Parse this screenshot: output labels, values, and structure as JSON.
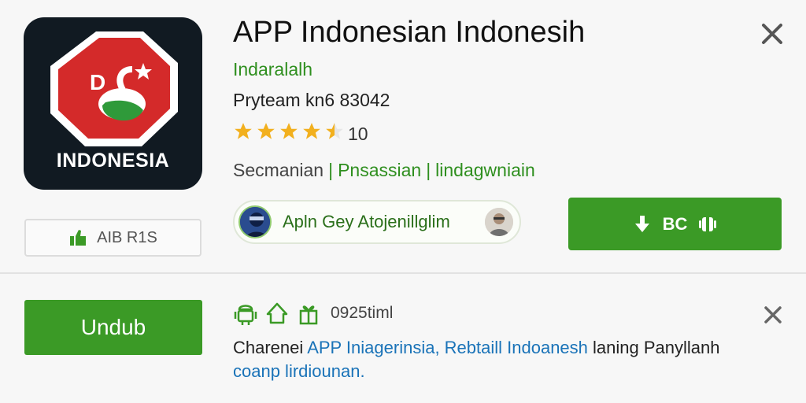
{
  "app": {
    "icon_text": "INDONESIA",
    "icon_badge": "D",
    "title": "APP Indonesian Indonesih",
    "developer": "Indaralalh",
    "subline": "Pryteam kn6 83042",
    "rating_count": "10",
    "rating_value": 4.5,
    "tags": [
      "Secmanian",
      "Pnsassian",
      "lindagwniain"
    ]
  },
  "rating_box": {
    "label": "AIB R1S",
    "icon": "thumbs-up-icon"
  },
  "user_pill": {
    "text": "Apln Gey Atojenillglim"
  },
  "install": {
    "label": "BC",
    "icon": "download-icon"
  },
  "bottom": {
    "download_label": "Undub",
    "size": "0925timl",
    "desc_plain_1": "Charenei ",
    "desc_link_1": "APP Iniagerinsia, Rebtaill Indoanesh",
    "desc_plain_2": " laning Panyllanh",
    "desc_link_2": "coanp lirdiounan."
  },
  "colors": {
    "accent_green": "#3b9a26",
    "text_green": "#2f8f1f",
    "link_blue": "#1a73b8",
    "icon_red": "#d42a2a",
    "icon_bg": "#111a22"
  }
}
